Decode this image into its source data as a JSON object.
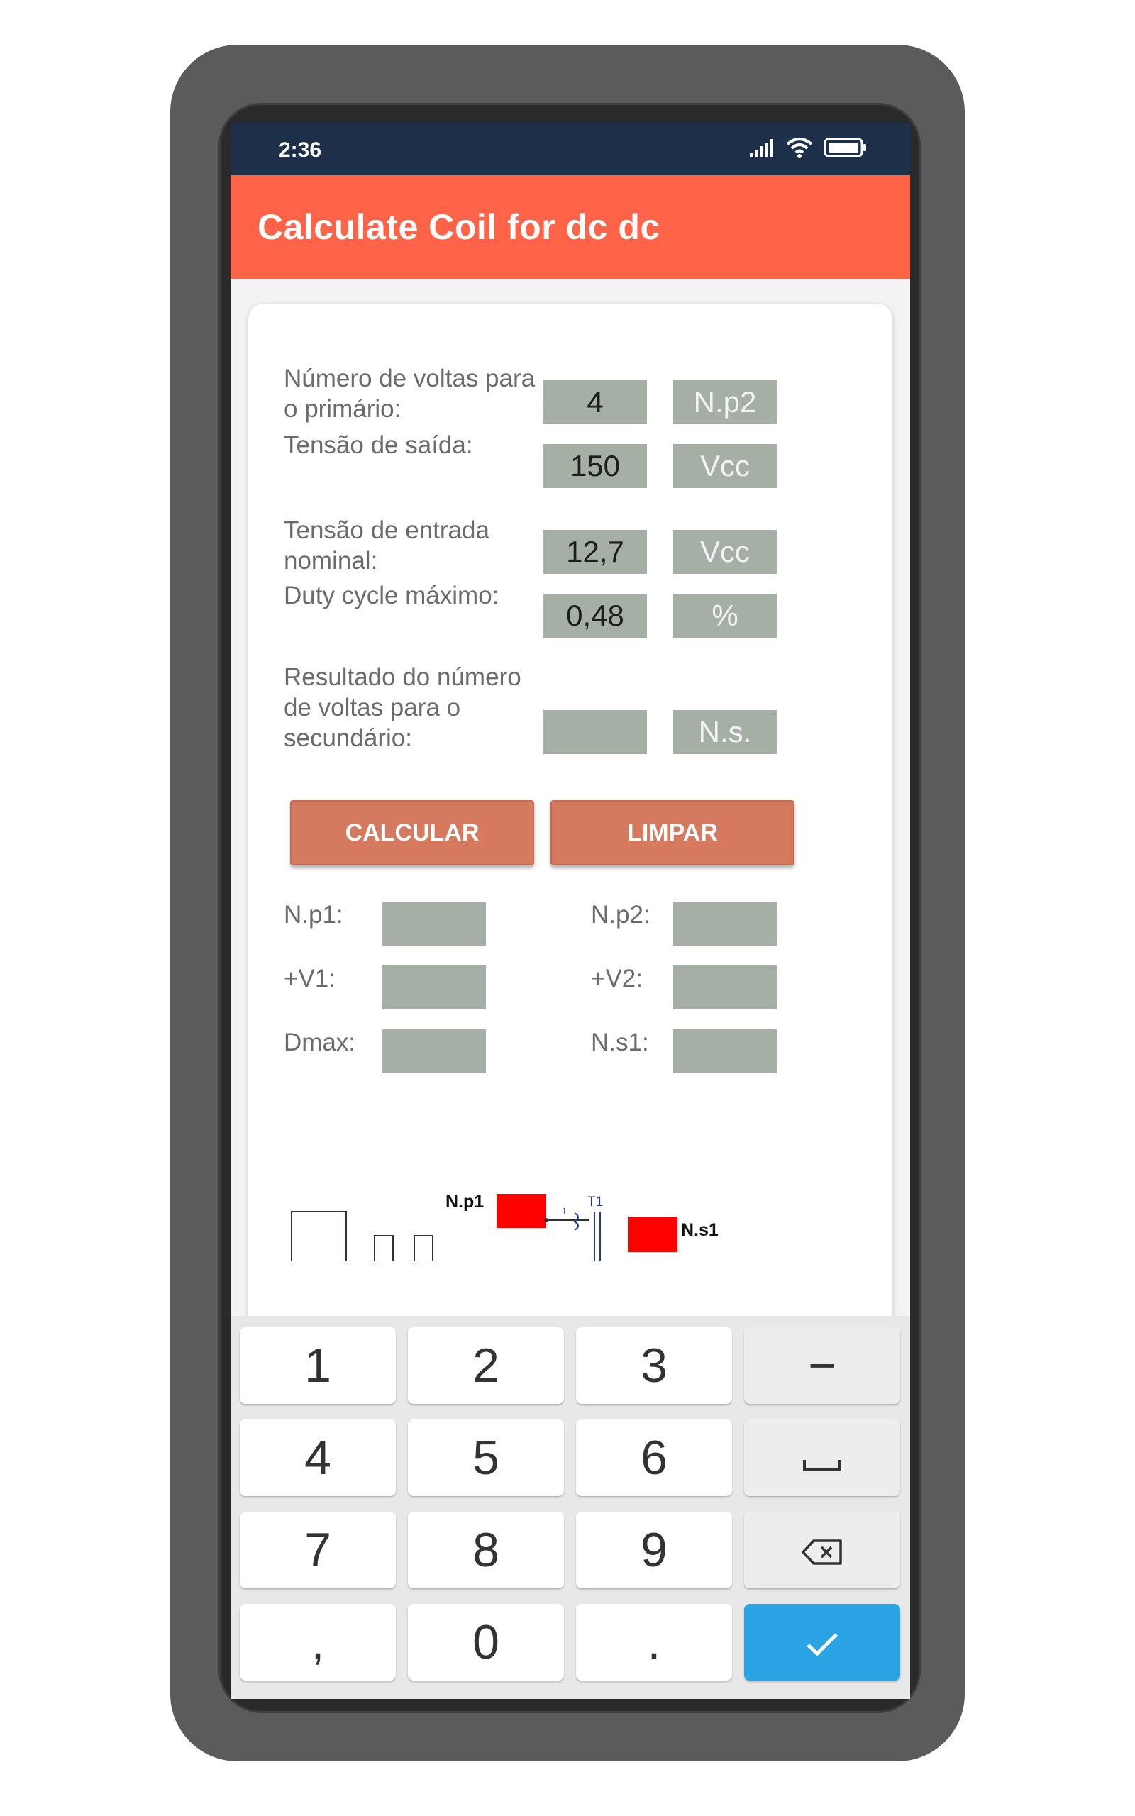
{
  "status_bar": {
    "time": "2:36"
  },
  "app_bar": {
    "title": "Calculate Coil for dc dc"
  },
  "form": {
    "rows": [
      {
        "label": "Número de voltas para o primário:",
        "value": "4",
        "unit": "N.p2"
      },
      {
        "label": "Tensão de saída:",
        "value": "150",
        "unit": "Vcc"
      },
      {
        "label": "Tensão de entrada nominal:",
        "value": "12,7",
        "unit": "Vcc"
      },
      {
        "label": "Duty cycle máximo:",
        "value": "0,48",
        "unit": "%"
      },
      {
        "label": "Resultado do número de voltas para o secundário:",
        "value": "",
        "unit": "N.s."
      }
    ]
  },
  "buttons": {
    "calculate": "CALCULAR",
    "clear": "LIMPAR"
  },
  "results": {
    "left": [
      {
        "label": "N.p1:",
        "value": ""
      },
      {
        "label": "+V1:",
        "value": ""
      },
      {
        "label": "Dmax:",
        "value": ""
      }
    ],
    "right": [
      {
        "label": "N.p2:",
        "value": ""
      },
      {
        "label": "+V2:",
        "value": ""
      },
      {
        "label": "N.s1:",
        "value": ""
      }
    ]
  },
  "diagram": {
    "np1_label": "N.p1",
    "ns1_label": "N.s1",
    "t1_label": "T1",
    "pin_label": "1"
  },
  "keyboard": {
    "keys": [
      "1",
      "2",
      "3",
      "−",
      "4",
      "5",
      "6",
      "␣",
      "7",
      "8",
      "9",
      "⌫",
      ",",
      "0",
      ".",
      "✓"
    ],
    "icons": {
      "space": "space-bar-icon",
      "backspace": "backspace-icon",
      "done": "checkmark-icon"
    }
  },
  "colors": {
    "app_bar": "#ff6448",
    "status_bar": "#1e3049",
    "button": "#d67a5f",
    "field": "#a5afa6",
    "done_key": "#2aa4e4"
  }
}
